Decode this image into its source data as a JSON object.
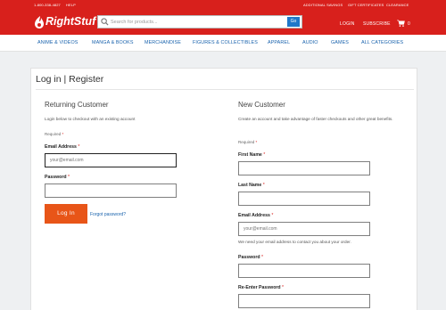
{
  "utility_bar": {
    "phone": "1-800-338-4827",
    "help": "HELP",
    "additional_savings": "ADDITIONAL SAVINGS",
    "gift_certificates": "GIFT CERTIFICATES",
    "clearance": "CLEARANCE"
  },
  "header": {
    "logo_text": "RightStuf",
    "search_placeholder": "Search for products...",
    "go_label": "Go",
    "login": "LOGIN",
    "subscribe": "SUBSCRIBE",
    "cart_count": "0",
    "brand_color": "#d8201c"
  },
  "nav": {
    "items": [
      "ANIME & VIDEOS",
      "MANGA & BOOKS",
      "MERCHANDISE",
      "FIGURES & COLLECTIBLES",
      "APPAREL",
      "AUDIO",
      "GAMES",
      "ALL CATEGORIES"
    ]
  },
  "page": {
    "title": "Log in | Register"
  },
  "returning": {
    "heading": "Returning Customer",
    "intro": "Login below to checkout with an existing account",
    "required_note": "Required",
    "email_label": "Email Address",
    "email_placeholder": "your@email.com",
    "password_label": "Password",
    "login_button": "Log In",
    "forgot_link": "Forgot password?"
  },
  "new_customer": {
    "heading": "New Customer",
    "intro": "Create an account and take advantage of faster checkouts and other great benefits.",
    "required_note": "Required",
    "first_name_label": "First Name",
    "last_name_label": "Last Name",
    "email_label": "Email Address",
    "email_placeholder": "your@email.com",
    "email_help": "We need your email address to contact you about your order.",
    "password_label": "Password",
    "reenter_password_label": "Re-Enter Password"
  }
}
